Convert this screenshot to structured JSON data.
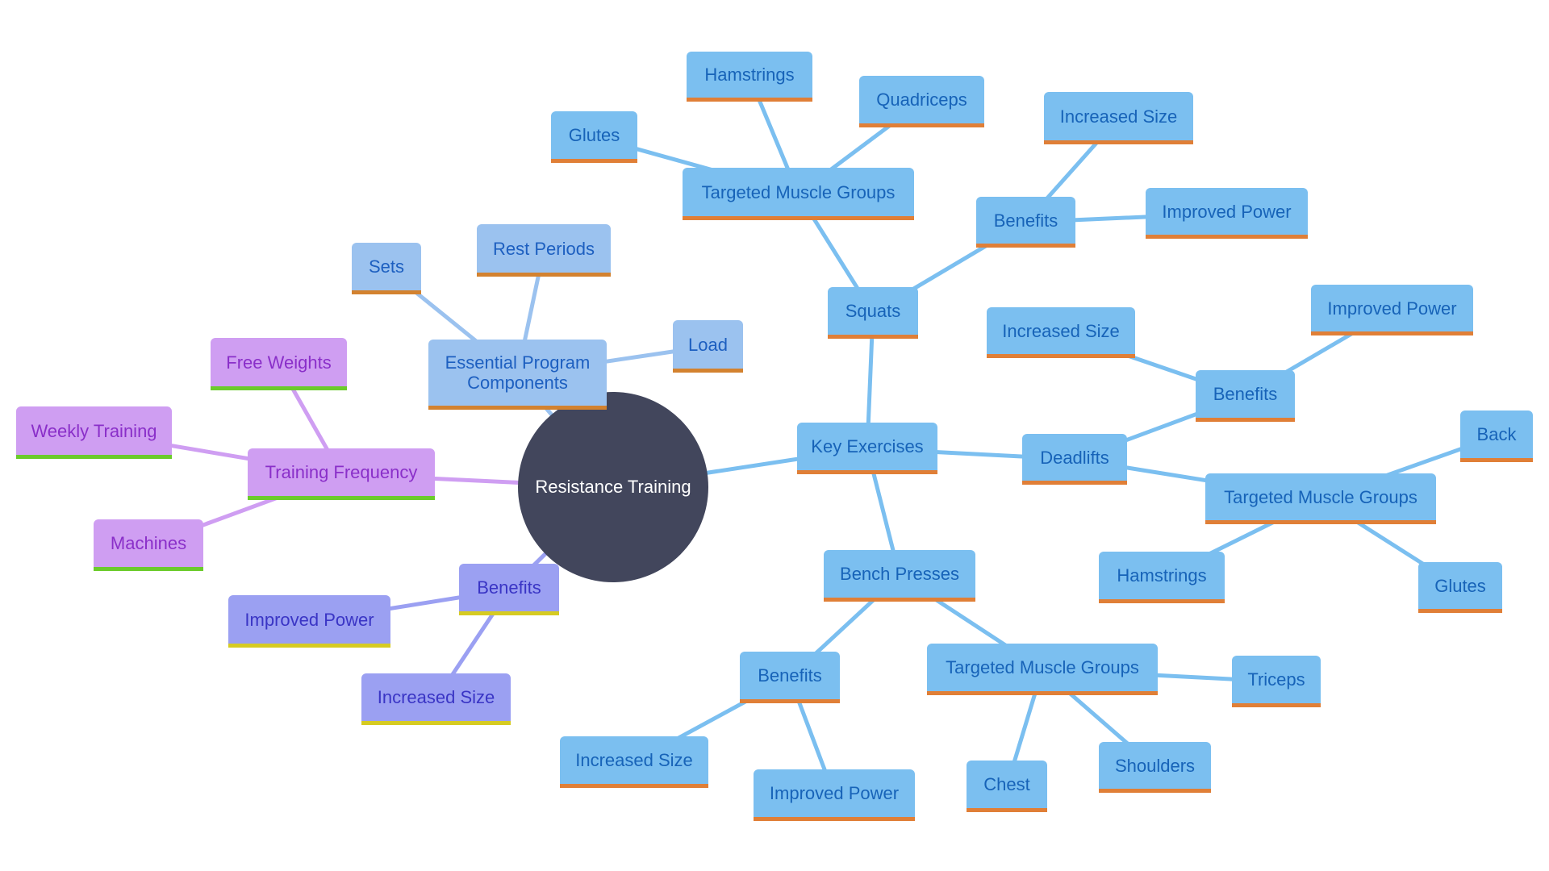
{
  "diagram": {
    "type": "mindmap",
    "root": {
      "id": "root",
      "label": "Resistance Training",
      "color": "#42465c"
    },
    "palette": {
      "key_exercises": {
        "fill": "#7bbff0",
        "text": "#1763b8",
        "accent": "#e07f37"
      },
      "essential": {
        "fill": "#9bc2ef",
        "text": "#1d5fc0",
        "accent": "#d3822f"
      },
      "frequency": {
        "fill": "#cf9ef2",
        "text": "#8a2fc9",
        "accent": "#6bcb2b"
      },
      "benefits": {
        "fill": "#9ba0f2",
        "text": "#3a35c5",
        "accent": "#d6cb22"
      }
    },
    "nodes": [
      {
        "id": "epc",
        "label": "Essential Program Components",
        "parent": "root",
        "group": "essential"
      },
      {
        "id": "epc_sets",
        "label": "Sets",
        "parent": "epc",
        "group": "essential"
      },
      {
        "id": "epc_rest",
        "label": "Rest Periods",
        "parent": "epc",
        "group": "essential"
      },
      {
        "id": "epc_load",
        "label": "Load",
        "parent": "epc",
        "group": "essential"
      },
      {
        "id": "tf",
        "label": "Training Frequency",
        "parent": "root",
        "group": "frequency"
      },
      {
        "id": "tf_free",
        "label": "Free Weights",
        "parent": "tf",
        "group": "frequency"
      },
      {
        "id": "tf_weekly",
        "label": "Weekly Training",
        "parent": "tf",
        "group": "frequency"
      },
      {
        "id": "tf_machines",
        "label": "Machines",
        "parent": "tf",
        "group": "frequency"
      },
      {
        "id": "ben",
        "label": "Benefits",
        "parent": "root",
        "group": "benefits"
      },
      {
        "id": "ben_power",
        "label": "Improved Power",
        "parent": "ben",
        "group": "benefits"
      },
      {
        "id": "ben_size",
        "label": "Increased Size",
        "parent": "ben",
        "group": "benefits"
      },
      {
        "id": "ke",
        "label": "Key Exercises",
        "parent": "root",
        "group": "key_exercises"
      },
      {
        "id": "sq",
        "label": "Squats",
        "parent": "ke",
        "group": "key_exercises"
      },
      {
        "id": "sq_tmg",
        "label": "Targeted Muscle Groups",
        "parent": "sq",
        "group": "key_exercises"
      },
      {
        "id": "sq_glutes",
        "label": "Glutes",
        "parent": "sq_tmg",
        "group": "key_exercises"
      },
      {
        "id": "sq_ham",
        "label": "Hamstrings",
        "parent": "sq_tmg",
        "group": "key_exercises"
      },
      {
        "id": "sq_quad",
        "label": "Quadriceps",
        "parent": "sq_tmg",
        "group": "key_exercises"
      },
      {
        "id": "sq_ben",
        "label": "Benefits",
        "parent": "sq",
        "group": "key_exercises"
      },
      {
        "id": "sq_size",
        "label": "Increased Size",
        "parent": "sq_ben",
        "group": "key_exercises"
      },
      {
        "id": "sq_power",
        "label": "Improved Power",
        "parent": "sq_ben",
        "group": "key_exercises"
      },
      {
        "id": "dl",
        "label": "Deadlifts",
        "parent": "ke",
        "group": "key_exercises"
      },
      {
        "id": "dl_ben",
        "label": "Benefits",
        "parent": "dl",
        "group": "key_exercises"
      },
      {
        "id": "dl_size",
        "label": "Increased Size",
        "parent": "dl_ben",
        "group": "key_exercises"
      },
      {
        "id": "dl_power",
        "label": "Improved Power",
        "parent": "dl_ben",
        "group": "key_exercises"
      },
      {
        "id": "dl_tmg",
        "label": "Targeted Muscle Groups",
        "parent": "dl",
        "group": "key_exercises"
      },
      {
        "id": "dl_back",
        "label": "Back",
        "parent": "dl_tmg",
        "group": "key_exercises"
      },
      {
        "id": "dl_ham",
        "label": "Hamstrings",
        "parent": "dl_tmg",
        "group": "key_exercises"
      },
      {
        "id": "dl_glutes",
        "label": "Glutes",
        "parent": "dl_tmg",
        "group": "key_exercises"
      },
      {
        "id": "bp",
        "label": "Bench Presses",
        "parent": "ke",
        "group": "key_exercises"
      },
      {
        "id": "bp_ben",
        "label": "Benefits",
        "parent": "bp",
        "group": "key_exercises"
      },
      {
        "id": "bp_size",
        "label": "Increased Size",
        "parent": "bp_ben",
        "group": "key_exercises"
      },
      {
        "id": "bp_power",
        "label": "Improved Power",
        "parent": "bp_ben",
        "group": "key_exercises"
      },
      {
        "id": "bp_tmg",
        "label": "Targeted Muscle Groups",
        "parent": "bp",
        "group": "key_exercises"
      },
      {
        "id": "bp_triceps",
        "label": "Triceps",
        "parent": "bp_tmg",
        "group": "key_exercises"
      },
      {
        "id": "bp_chest",
        "label": "Chest",
        "parent": "bp_tmg",
        "group": "key_exercises"
      },
      {
        "id": "bp_shoulders",
        "label": "Shoulders",
        "parent": "bp_tmg",
        "group": "key_exercises"
      }
    ]
  }
}
